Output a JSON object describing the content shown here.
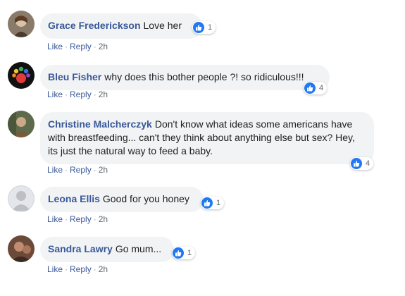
{
  "comments": [
    {
      "author": "Grace Frederickson",
      "text": "Love her",
      "reactions": "1",
      "like": "Like",
      "reply": "Reply",
      "time": "2h"
    },
    {
      "author": "Bleu Fisher",
      "text": "why does this bother people ?! so ridiculous!!!",
      "reactions": "4",
      "like": "Like",
      "reply": "Reply",
      "time": "2h"
    },
    {
      "author": "Christine Malcherczyk",
      "text": "Don't know what ideas some americans have with breastfeeding... can't they think about anything else but sex? Hey, its just the natural way to feed a baby.",
      "reactions": "4",
      "like": "Like",
      "reply": "Reply",
      "time": "2h"
    },
    {
      "author": "Leona Ellis",
      "text": "Good for you honey",
      "reactions": "1",
      "like": "Like",
      "reply": "Reply",
      "time": "2h"
    },
    {
      "author": "Sandra Lawry",
      "text": "Go mum...",
      "reactions": "1",
      "like": "Like",
      "reply": "Reply",
      "time": "2h"
    }
  ],
  "colors": {
    "author": "#385898",
    "bubble": "#f2f3f5",
    "like_badge": "#2078f4"
  },
  "icons": [
    "avatar",
    "like-icon"
  ]
}
